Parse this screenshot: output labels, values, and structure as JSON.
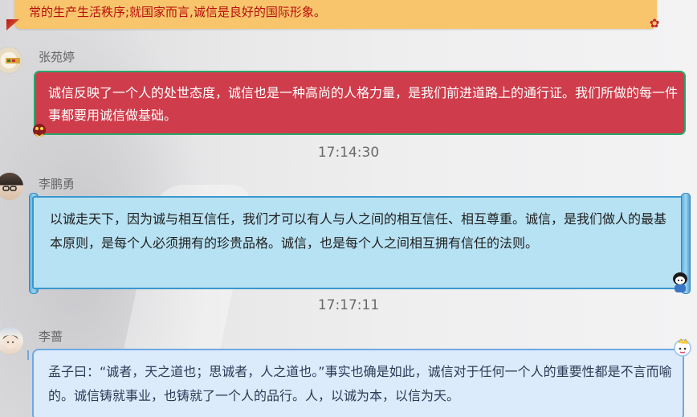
{
  "messages": [
    {
      "text": "常的生产生活秩序;就国家而言,诚信是良好的国际形象。"
    },
    {
      "sender": "张苑婷",
      "text": "诚信反映了一个人的处世态度，诚信也是一种高尚的人格力量，是我们前进道路上的通行证。我们所做的每一件事都要用诚信做基础。",
      "timestamp_after": "17:14:30"
    },
    {
      "sender": "李鹏勇",
      "text": "以诚走天下，因为诚与相互信任，我们才可以有人与人之间的相互信任、相互尊重。诚信，是我们做人的最基本原则，是每个人必须拥有的珍贵品格。诚信，也是每个人之间相互拥有信任的法则。",
      "timestamp_after": "17:17:11"
    },
    {
      "sender": "李蔷",
      "text": "孟子曰：“诚者，天之道也；思诚者，人之道也。”事实也确是如此，诚信对于任何一个人的重要性都是不言而喻的。诚信铸就事业，也铸就了一个人的品行。人，以诚为本，以信为天。"
    }
  ],
  "colors": {
    "bubble_top": "#f8c56d",
    "bubble_red": "#cf3c4b",
    "bubble_blue": "#b7e2f3",
    "bubble_light_blue": "#dcebfb"
  }
}
